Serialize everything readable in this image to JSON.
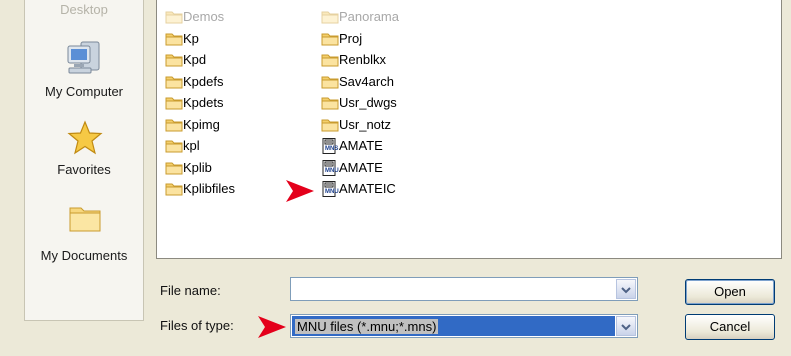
{
  "places": [
    {
      "label": "Desktop",
      "icon": "desktop-icon"
    },
    {
      "label": "My Computer",
      "icon": "my-computer-icon"
    },
    {
      "label": "Favorites",
      "icon": "star-icon"
    },
    {
      "label": "My Documents",
      "icon": "folder-icon"
    }
  ],
  "files": {
    "col1": [
      {
        "name": "Demos",
        "type": "folder",
        "faded": true
      },
      {
        "name": "Kp",
        "type": "folder",
        "faded": false
      },
      {
        "name": "Kpd",
        "type": "folder",
        "faded": false
      },
      {
        "name": "Kpdefs",
        "type": "folder",
        "faded": false
      },
      {
        "name": "Kpdets",
        "type": "folder",
        "faded": false
      },
      {
        "name": "Kpimg",
        "type": "folder",
        "faded": false
      },
      {
        "name": "kpl",
        "type": "folder",
        "faded": false
      },
      {
        "name": "Kplib",
        "type": "folder",
        "faded": false
      },
      {
        "name": "Kplibfiles",
        "type": "folder",
        "faded": false
      }
    ],
    "col2": [
      {
        "name": "Panorama",
        "type": "folder",
        "faded": true
      },
      {
        "name": "Proj",
        "type": "folder",
        "faded": false
      },
      {
        "name": "Renblkx",
        "type": "folder",
        "faded": false
      },
      {
        "name": "Sav4arch",
        "type": "folder",
        "faded": false
      },
      {
        "name": "Usr_dwgs",
        "type": "folder",
        "faded": false
      },
      {
        "name": "Usr_notz",
        "type": "folder",
        "faded": false
      },
      {
        "name": "AMATE",
        "type": "mns",
        "badge": "MNS",
        "faded": false
      },
      {
        "name": "AMATE",
        "type": "mnu",
        "badge": "MNU",
        "faded": false
      },
      {
        "name": "AMATEIC",
        "type": "mnu",
        "badge": "MNU",
        "faded": false
      }
    ]
  },
  "form": {
    "file_name_label": "File name:",
    "file_name_value": "",
    "files_of_type_label": "Files of type:",
    "files_of_type_value": "MNU files (*.mnu;*.mns)",
    "open_label": "Open",
    "cancel_label": "Cancel"
  },
  "colors": {
    "folder": "#f4cf6c",
    "folder_edge": "#c99b2e",
    "arrow": "#e4001b",
    "highlight": "#316ac5"
  }
}
